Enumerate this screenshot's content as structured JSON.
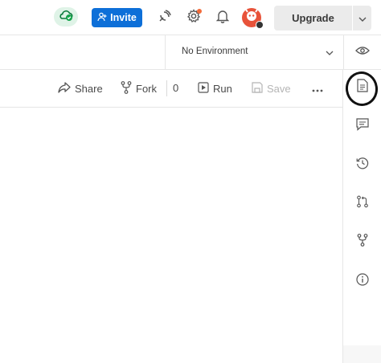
{
  "header": {
    "invite_label": "Invite",
    "upgrade_label": "Upgrade",
    "accent_color": "#0d6fd8",
    "icons": [
      "cloud-sync-icon",
      "user-plus-icon",
      "satellite-icon",
      "gear-icon",
      "bell-icon",
      "avatar",
      "chevron-down-icon"
    ]
  },
  "environment": {
    "selected": "No Environment"
  },
  "toolbar": {
    "share_label": "Share",
    "fork_label": "Fork",
    "fork_count": "0",
    "run_label": "Run",
    "save_label": "Save"
  },
  "sidebar": {
    "items": [
      {
        "name": "documentation-icon"
      },
      {
        "name": "comments-icon"
      },
      {
        "name": "history-icon"
      },
      {
        "name": "pull-request-icon"
      },
      {
        "name": "fork-icon"
      },
      {
        "name": "info-icon"
      }
    ]
  }
}
